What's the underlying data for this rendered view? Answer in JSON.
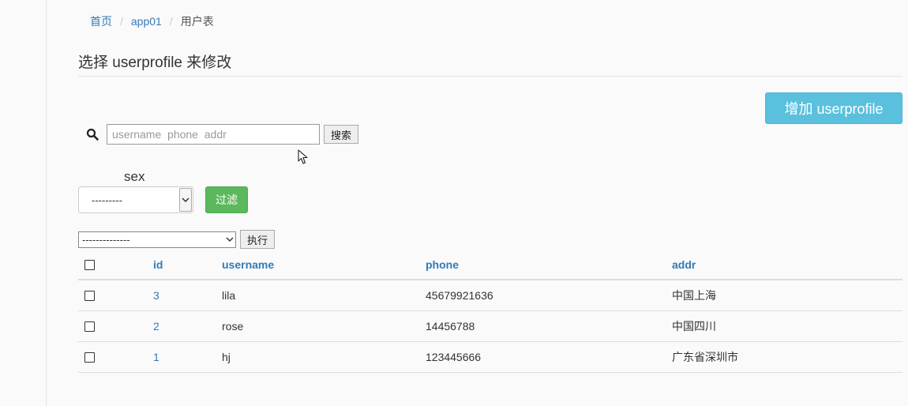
{
  "breadcrumb": {
    "home": "首页",
    "app": "app01",
    "current": "用户表",
    "separator": "/"
  },
  "page_title": "选择 userprofile 来修改",
  "add_button": "增加 userprofile",
  "search": {
    "placeholder": "username  phone  addr",
    "button": "搜索"
  },
  "filter": {
    "label": "sex",
    "selected": "---------",
    "button": "过滤"
  },
  "actions": {
    "selected": "--------------",
    "button": "执行"
  },
  "table": {
    "columns": [
      "id",
      "username",
      "phone",
      "addr"
    ],
    "rows": [
      {
        "id": "3",
        "username": "lila",
        "phone": "45679921636",
        "addr": "中国上海"
      },
      {
        "id": "2",
        "username": "rose",
        "phone": "14456788",
        "addr": "中国四川"
      },
      {
        "id": "1",
        "username": "hj",
        "phone": "123445666",
        "addr": "广东省深圳市"
      }
    ]
  },
  "colors": {
    "link": "#337ab7",
    "info": "#5bc0de",
    "success": "#5cb85c"
  },
  "icons": {
    "search": "search-icon",
    "dropdown": "chevron-down-icon",
    "cursor": "mouse-pointer-icon"
  }
}
